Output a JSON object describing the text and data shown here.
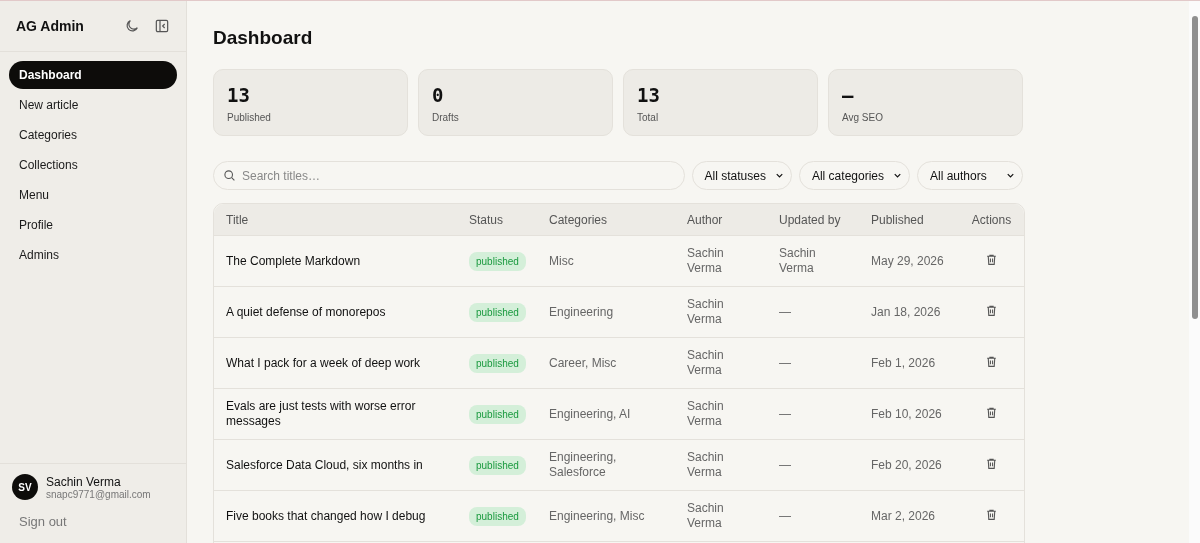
{
  "sidebar": {
    "brand": "AG Admin",
    "items": [
      {
        "label": "Dashboard",
        "selected": true
      },
      {
        "label": "New article",
        "selected": false
      },
      {
        "label": "Categories",
        "selected": false
      },
      {
        "label": "Collections",
        "selected": false
      },
      {
        "label": "Menu",
        "selected": false
      },
      {
        "label": "Profile",
        "selected": false
      },
      {
        "label": "Admins",
        "selected": false
      }
    ],
    "user": {
      "initials": "SV",
      "name": "Sachin Verma",
      "email": "snapc9771@gmail.com"
    },
    "sign_out": "Sign out"
  },
  "page_title": "Dashboard",
  "stats": [
    {
      "value": "13",
      "label": "Published"
    },
    {
      "value": "0",
      "label": "Drafts"
    },
    {
      "value": "13",
      "label": "Total"
    },
    {
      "value": "—",
      "label": "Avg SEO"
    }
  ],
  "search": {
    "placeholder": "Search titles…"
  },
  "filters": [
    "All statuses",
    "All categories",
    "All authors"
  ],
  "table": {
    "columns": [
      "Title",
      "Status",
      "Categories",
      "Author",
      "Updated by",
      "Published",
      "Actions"
    ],
    "rows": [
      {
        "title": "The Complete Markdown",
        "status": "published",
        "categories": "Misc",
        "author": "Sachin Verma",
        "updated_by": "Sachin Verma",
        "published": "May 29, 2026"
      },
      {
        "title": "A quiet defense of monorepos",
        "status": "published",
        "categories": "Engineering",
        "author": "Sachin Verma",
        "updated_by": "—",
        "published": "Jan 18, 2026"
      },
      {
        "title": "What I pack for a week of deep work",
        "status": "published",
        "categories": "Career, Misc",
        "author": "Sachin Verma",
        "updated_by": "—",
        "published": "Feb 1, 2026"
      },
      {
        "title": "Evals are just tests with worse error messages",
        "status": "published",
        "categories": "Engineering, AI",
        "author": "Sachin Verma",
        "updated_by": "—",
        "published": "Feb 10, 2026"
      },
      {
        "title": "Salesforce Data Cloud, six months in",
        "status": "published",
        "categories": "Engineering, Salesforce",
        "author": "Sachin Verma",
        "updated_by": "—",
        "published": "Feb 20, 2026"
      },
      {
        "title": "Five books that changed how I debug",
        "status": "published",
        "categories": "Engineering, Misc",
        "author": "Sachin Verma",
        "updated_by": "—",
        "published": "Mar 2, 2026"
      }
    ]
  }
}
